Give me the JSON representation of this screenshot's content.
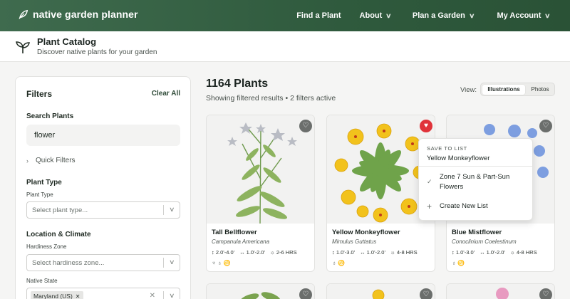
{
  "brand": {
    "name": "native garden planner"
  },
  "nav": {
    "items": [
      {
        "label": "Find a Plant",
        "dropdown": false
      },
      {
        "label": "About",
        "dropdown": true
      },
      {
        "label": "Plan a Garden",
        "dropdown": true
      },
      {
        "label": "My Account",
        "dropdown": true
      }
    ]
  },
  "page": {
    "title": "Plant Catalog",
    "subtitle": "Discover native plants for your garden"
  },
  "filters": {
    "title": "Filters",
    "clear_label": "Clear All",
    "search_label": "Search Plants",
    "search_value": "flower",
    "quick_filters_label": "Quick Filters",
    "plant_type_heading": "Plant Type",
    "plant_type_label": "Plant Type",
    "plant_type_placeholder": "Select plant type...",
    "location_heading": "Location & Climate",
    "hardiness_label": "Hardiness Zone",
    "hardiness_placeholder": "Select hardiness zone...",
    "native_state_label": "Native State",
    "native_state_chip": "Maryland (US)"
  },
  "results": {
    "count_label": "1164 Plants",
    "summary": "Showing filtered results • 2 filters active",
    "view_label": "View:",
    "view_options": [
      "Illustrations",
      "Photos"
    ],
    "view_selected": "Illustrations"
  },
  "plants": [
    {
      "name": "Tall Bellflower",
      "latin": "Campanula Americana",
      "height": "2.0'-4.0'",
      "spread": "1.0'-2.0'",
      "sun": "2-6 HRS",
      "saved": false,
      "tags": "♆ ♁ ♋"
    },
    {
      "name": "Yellow Monkeyflower",
      "latin": "Mimulus Guttatus",
      "height": "1.0'-3.0'",
      "spread": "1.0'-2.0'",
      "sun": "4-8 HRS",
      "saved": true,
      "tags": "♁ ♋"
    },
    {
      "name": "Blue Mistflower",
      "latin": "Conoclinium Coelestinum",
      "height": "1.0'-3.0'",
      "spread": "1.0'-2.0'",
      "sun": "4-8 HRS",
      "saved": false,
      "tags": "♁ ♋"
    }
  ],
  "save_popup": {
    "heading": "SAVE TO LIST",
    "plant_name": "Yellow Monkeyflower",
    "list_item": "Zone 7 Sun & Part-Sun Flowers",
    "create_label": "Create New List"
  },
  "colors": {
    "nav_bg": "#2f5a3d",
    "heart_active": "#e0323a",
    "heart_inactive": "#6b6e6c"
  }
}
